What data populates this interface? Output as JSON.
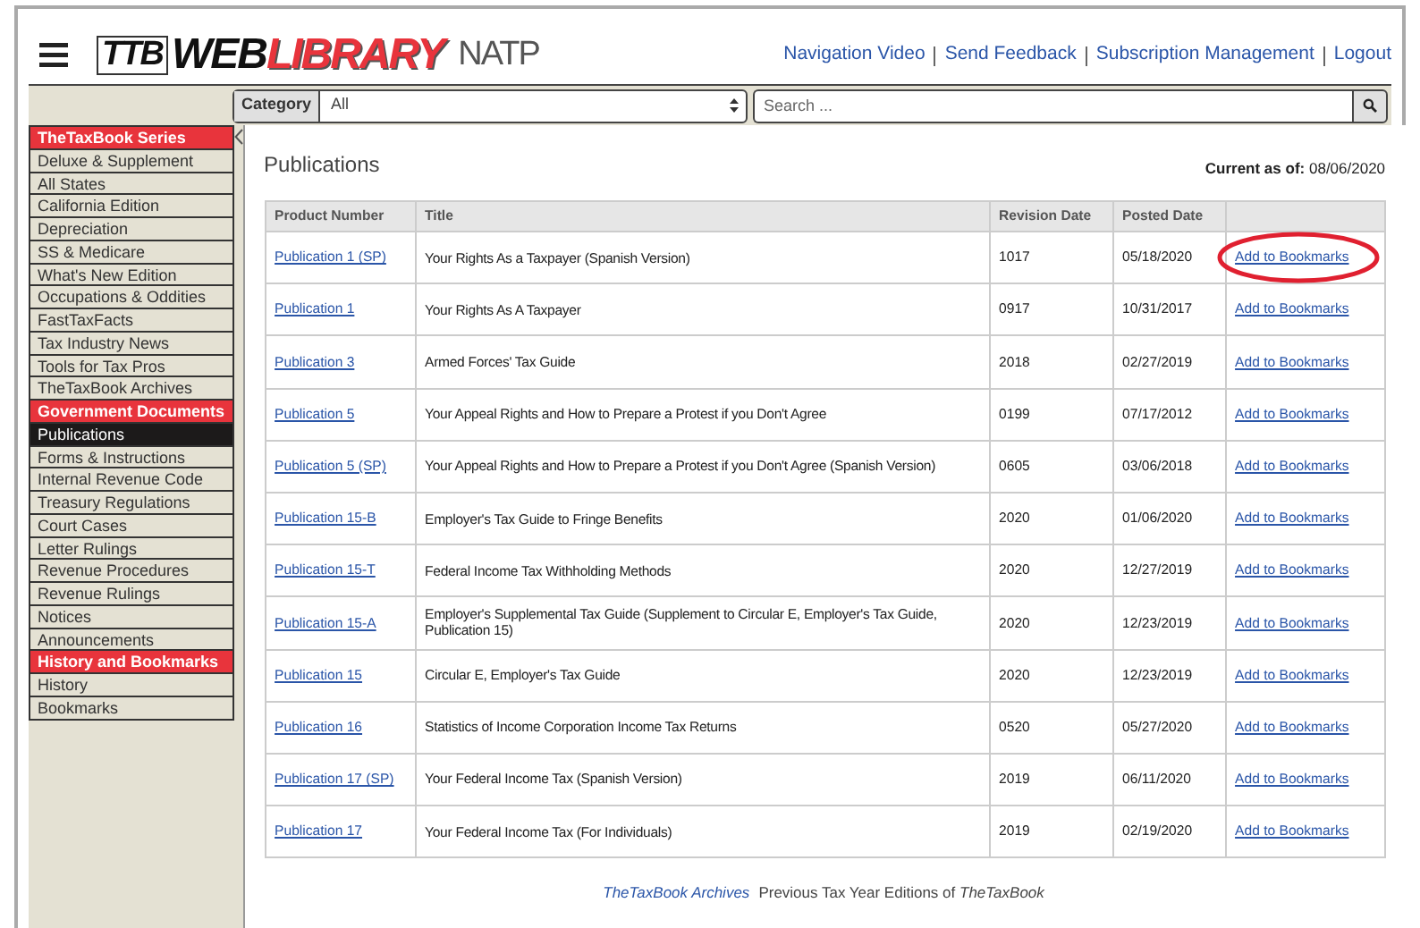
{
  "header": {
    "logo": {
      "badge": "TTB",
      "word_1": "WEB",
      "word_2": "LIBRARY",
      "partner": "NATP"
    },
    "links": [
      "Navigation Video",
      "Send Feedback",
      "Subscription Management",
      "Logout"
    ]
  },
  "filter": {
    "category_label": "Category",
    "category_value": "All",
    "search_placeholder": "Search ..."
  },
  "sidebar": {
    "items": [
      {
        "kind": "header",
        "label": "TheTaxBook Series"
      },
      {
        "kind": "item",
        "label": "Deluxe & Supplement",
        "selected": false
      },
      {
        "kind": "item",
        "label": "All States",
        "selected": false
      },
      {
        "kind": "item",
        "label": "California Edition",
        "selected": false
      },
      {
        "kind": "item",
        "label": "Depreciation",
        "selected": false
      },
      {
        "kind": "item",
        "label": "SS & Medicare",
        "selected": false
      },
      {
        "kind": "item",
        "label": "What's New Edition",
        "selected": false
      },
      {
        "kind": "item",
        "label": "Occupations & Oddities",
        "selected": false
      },
      {
        "kind": "item",
        "label": "FastTaxFacts",
        "selected": false
      },
      {
        "kind": "item",
        "label": "Tax Industry News",
        "selected": false
      },
      {
        "kind": "item",
        "label": "Tools for Tax Pros",
        "selected": false
      },
      {
        "kind": "item",
        "label": "TheTaxBook Archives",
        "selected": false
      },
      {
        "kind": "header",
        "label": "Government Documents"
      },
      {
        "kind": "item",
        "label": "Publications",
        "selected": true
      },
      {
        "kind": "item",
        "label": "Forms & Instructions",
        "selected": false
      },
      {
        "kind": "item",
        "label": "Internal Revenue Code",
        "selected": false
      },
      {
        "kind": "item",
        "label": "Treasury Regulations",
        "selected": false
      },
      {
        "kind": "item",
        "label": "Court Cases",
        "selected": false
      },
      {
        "kind": "item",
        "label": "Letter Rulings",
        "selected": false
      },
      {
        "kind": "item",
        "label": "Revenue Procedures",
        "selected": false
      },
      {
        "kind": "item",
        "label": "Revenue Rulings",
        "selected": false
      },
      {
        "kind": "item",
        "label": "Notices",
        "selected": false
      },
      {
        "kind": "item",
        "label": "Announcements",
        "selected": false
      },
      {
        "kind": "header",
        "label": "History and Bookmarks"
      },
      {
        "kind": "item",
        "label": "History",
        "selected": false
      },
      {
        "kind": "item",
        "label": "Bookmarks",
        "selected": false
      }
    ]
  },
  "main": {
    "title": "Publications",
    "current_label": "Current as of:",
    "current_date": "08/06/2020",
    "table": {
      "columns": [
        "Product Number",
        "Title",
        "Revision Date",
        "Posted Date"
      ],
      "rows": [
        {
          "product": "Publication 1 (SP)",
          "title": "Your Rights As a Taxpayer (Spanish Version)",
          "revision": "1017",
          "posted": "05/18/2020",
          "action": "Add to Bookmarks",
          "circled": true
        },
        {
          "product": "Publication 1",
          "title": "Your Rights As A Taxpayer",
          "revision": "0917",
          "posted": "10/31/2017",
          "action": "Add to Bookmarks",
          "circled": false
        },
        {
          "product": "Publication 3",
          "title": "Armed Forces' Tax Guide",
          "revision": "2018",
          "posted": "02/27/2019",
          "action": "Add to Bookmarks",
          "circled": false
        },
        {
          "product": "Publication 5",
          "title": "Your Appeal Rights and How to Prepare a Protest if you Don't Agree",
          "revision": "0199",
          "posted": "07/17/2012",
          "action": "Add to Bookmarks",
          "circled": false
        },
        {
          "product": "Publication 5 (SP)",
          "title": "Your Appeal Rights and How to Prepare a Protest if you Don't Agree (Spanish Version)",
          "revision": "0605",
          "posted": "03/06/2018",
          "action": "Add to Bookmarks",
          "circled": false
        },
        {
          "product": "Publication 15-B",
          "title": "Employer's Tax Guide to Fringe Benefits",
          "revision": "2020",
          "posted": "01/06/2020",
          "action": "Add to Bookmarks",
          "circled": false
        },
        {
          "product": "Publication 15-T",
          "title": "Federal Income Tax Withholding Methods",
          "revision": "2020",
          "posted": "12/27/2019",
          "action": "Add to Bookmarks",
          "circled": false
        },
        {
          "product": "Publication 15-A",
          "title": "Employer's Supplemental Tax Guide (Supplement to Circular E, Employer's Tax Guide, Publication 15)",
          "revision": "2020",
          "posted": "12/23/2019",
          "action": "Add to Bookmarks",
          "circled": false
        },
        {
          "product": "Publication 15",
          "title": "Circular E, Employer's Tax Guide",
          "revision": "2020",
          "posted": "12/23/2019",
          "action": "Add to Bookmarks",
          "circled": false
        },
        {
          "product": "Publication 16",
          "title": "Statistics of Income Corporation Income Tax Returns",
          "revision": "0520",
          "posted": "05/27/2020",
          "action": "Add to Bookmarks",
          "circled": false
        },
        {
          "product": "Publication 17 (SP)",
          "title": "Your Federal Income Tax (Spanish Version)",
          "revision": "2019",
          "posted": "06/11/2020",
          "action": "Add to Bookmarks",
          "circled": false
        },
        {
          "product": "Publication 17",
          "title": "Your Federal Income Tax (For Individuals)",
          "revision": "2019",
          "posted": "02/19/2020",
          "action": "Add to Bookmarks",
          "circled": false
        }
      ]
    },
    "footer": {
      "link": "TheTaxBook Archives",
      "text": "Previous Tax Year Editions of *TheTaxBook*"
    }
  }
}
